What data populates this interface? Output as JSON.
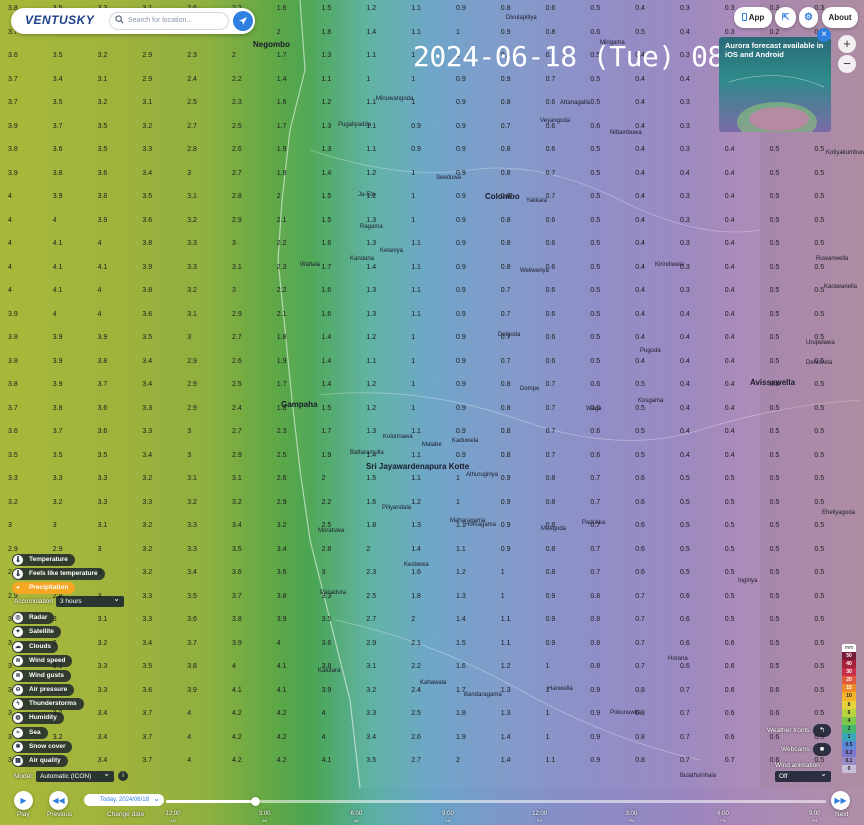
{
  "header": {
    "logo": "VENTUSKY",
    "search_placeholder": "Search for location..."
  },
  "datetime": "2024-06-18 (Tue) 08:30AM",
  "top_buttons": {
    "app": "App",
    "about": "About"
  },
  "promo": {
    "text": "Aurora forecast available in iOS and Android"
  },
  "map": {
    "cities": [
      {
        "name": "Colombo"
      },
      {
        "name": "Gampaha"
      },
      {
        "name": "Avissawella"
      },
      {
        "name": "Sri Jayawardenapura Kotte"
      },
      {
        "name": "Negombo"
      }
    ],
    "places": [
      {
        "name": "Ragama"
      },
      {
        "name": "Kelaniya"
      },
      {
        "name": "Wattala"
      },
      {
        "name": "Delgoda"
      },
      {
        "name": "Dompe"
      },
      {
        "name": "Kaduwela"
      },
      {
        "name": "Homagama"
      },
      {
        "name": "Padukka"
      },
      {
        "name": "Hanwella"
      },
      {
        "name": "Kosgama"
      },
      {
        "name": "Kirindiwela"
      },
      {
        "name": "Nittambuwa"
      },
      {
        "name": "Yakkala"
      },
      {
        "name": "Weliweriya"
      },
      {
        "name": "Minuwangoda"
      },
      {
        "name": "Divulapitiya"
      },
      {
        "name": "Veyangoda"
      },
      {
        "name": "Pugoda"
      },
      {
        "name": "Ruwanwella"
      },
      {
        "name": "Kotiyakumbura"
      },
      {
        "name": "Karawanella"
      },
      {
        "name": "Dehiowita"
      },
      {
        "name": "Urupelawa"
      },
      {
        "name": "Eheliyagoda"
      },
      {
        "name": "Kalutara"
      },
      {
        "name": "Panadura"
      },
      {
        "name": "Moratuwa"
      },
      {
        "name": "Horana"
      },
      {
        "name": "Ingiriya"
      },
      {
        "name": "Bulathsinhala"
      },
      {
        "name": "Maharagama"
      },
      {
        "name": "Kesbewa"
      },
      {
        "name": "Piliyandala"
      },
      {
        "name": "Malabe"
      },
      {
        "name": "Athurugiriya"
      },
      {
        "name": "Battaramulla"
      },
      {
        "name": "Kolonnawa"
      },
      {
        "name": "Ja-Ela"
      },
      {
        "name": "Kandana"
      },
      {
        "name": "Seeduwa"
      },
      {
        "name": "Mirigama"
      },
      {
        "name": "Attanagalla"
      },
      {
        "name": "Pugaliyadda"
      },
      {
        "name": "Waga"
      },
      {
        "name": "Meegoda"
      },
      {
        "name": "Kahawala"
      },
      {
        "name": "Bandaragama"
      },
      {
        "name": "Pokunuwita"
      }
    ]
  },
  "layers": [
    {
      "label": "Temperature",
      "icon": "thermometer-icon"
    },
    {
      "label": "Feels like temperature",
      "icon": "thermometer-icon"
    },
    {
      "label": "Precipitation",
      "icon": "drop-icon",
      "active": true
    },
    {
      "label": "Radar",
      "icon": "radar-icon"
    },
    {
      "label": "Satellite",
      "icon": "satellite-icon"
    },
    {
      "label": "Clouds",
      "icon": "cloud-icon"
    },
    {
      "label": "Wind speed",
      "icon": "wind-icon"
    },
    {
      "label": "Wind gusts",
      "icon": "wind-icon"
    },
    {
      "label": "Air pressure",
      "icon": "pressure-icon"
    },
    {
      "label": "Thunderstorms",
      "icon": "lightning-icon"
    },
    {
      "label": "Humidity",
      "icon": "humidity-icon"
    },
    {
      "label": "Sea",
      "icon": "waves-icon"
    },
    {
      "label": "Snow cover",
      "icon": "snowflake-icon"
    },
    {
      "label": "Air quality",
      "icon": "air-quality-icon"
    }
  ],
  "accumulation": {
    "label": "Accumulation:",
    "value": "3 hours"
  },
  "model": {
    "label": "Model:",
    "value": "Automatic (ICON)"
  },
  "legend": {
    "unit": "mm",
    "values": [
      "50",
      "40",
      "30",
      "20",
      "15",
      "10",
      "8",
      "6",
      "4",
      "2",
      "1",
      "0.5",
      "0.2",
      "0.1",
      "0"
    ],
    "colors": [
      "#7a1a3a",
      "#a8213c",
      "#c8304a",
      "#e25a3c",
      "#ef8a2a",
      "#f4b22a",
      "#e6d23a",
      "#b8d43e",
      "#7cc84a",
      "#44b870",
      "#3aa8b8",
      "#5a88d8",
      "#7a7ad0",
      "#9a8ac8",
      "#c8c0d8"
    ]
  },
  "side_controls": {
    "weather_fronts": "Weather fronts",
    "webcams": "Webcams",
    "wind_animation": "Wind animation",
    "wind_animation_value": "Off"
  },
  "timeline": {
    "play": "Play",
    "previous": "Previous",
    "change_date": "Change date",
    "next": "Next",
    "date_value": "Today, 2024/06/18",
    "progress": 0.135,
    "ticks": [
      {
        "time": "12:00",
        "ampm": "AM"
      },
      {
        "time": "3:00",
        "ampm": "AM"
      },
      {
        "time": "6:00",
        "ampm": "AM"
      },
      {
        "time": "9:00",
        "ampm": "AM"
      },
      {
        "time": "12:00",
        "ampm": "PM"
      },
      {
        "time": "3:00",
        "ampm": "PM"
      },
      {
        "time": "6:00",
        "ampm": "PM"
      },
      {
        "time": "9:00",
        "ampm": "PM"
      }
    ]
  },
  "grid_values": [
    [
      "3.8",
      "3.5",
      "3.3",
      "3.1",
      "2.6",
      "2.2",
      "1.6",
      "1.5",
      "1.2",
      "1.1",
      "0.9",
      "0.8",
      "0.6",
      "0.5",
      "0.4",
      "0.3",
      "0.3",
      "0.3",
      "0.3"
    ],
    [
      "3.7",
      "3.4",
      "3.2",
      "2.9",
      "2.7",
      "2.4",
      "2",
      "1.8",
      "1.4",
      "1.1",
      "1",
      "0.9",
      "0.8",
      "0.6",
      "0.5",
      "0.4",
      "0.3",
      "0.2",
      "0.3"
    ],
    [
      "3.6",
      "3.5",
      "3.2",
      "2.9",
      "2.3",
      "2",
      "1.7",
      "1.3",
      "1.1",
      "1",
      "1",
      "0.9",
      "0.7",
      "0.5",
      "0.4",
      "0.3",
      "0.3",
      "0.3",
      "0.3"
    ],
    [
      "3.7",
      "3.4",
      "3.1",
      "2.9",
      "2.4",
      "2.2",
      "1.4",
      "1.1",
      "1",
      "1",
      "0.9",
      "0.9",
      "0.7",
      "0.5",
      "0.4",
      "0.4",
      "0.3",
      "0.4",
      "0.4"
    ],
    [
      "3.7",
      "3.5",
      "3.2",
      "3.1",
      "2.5",
      "2.3",
      "1.6",
      "1.2",
      "1.1",
      "1",
      "0.9",
      "0.8",
      "0.6",
      "0.5",
      "0.4",
      "0.3",
      "0.3",
      "0.4",
      "0.4"
    ],
    [
      "3.9",
      "3.7",
      "3.5",
      "3.2",
      "2.7",
      "2.5",
      "1.7",
      "1.3",
      "1.1",
      "0.9",
      "0.9",
      "0.7",
      "0.6",
      "0.6",
      "0.4",
      "0.3",
      "0.4",
      "0.4",
      "0.5"
    ],
    [
      "3.8",
      "3.6",
      "3.5",
      "3.3",
      "2.8",
      "2.6",
      "1.9",
      "1.3",
      "1.1",
      "0.9",
      "0.9",
      "0.8",
      "0.6",
      "0.5",
      "0.4",
      "0.3",
      "0.4",
      "0.5",
      "0.5"
    ],
    [
      "3.9",
      "3.8",
      "3.6",
      "3.4",
      "3",
      "2.7",
      "1.8",
      "1.4",
      "1.2",
      "1",
      "0.9",
      "0.8",
      "0.7",
      "0.5",
      "0.4",
      "0.4",
      "0.4",
      "0.5",
      "0.5"
    ],
    [
      "4",
      "3.9",
      "3.8",
      "3.5",
      "3.1",
      "2.8",
      "2",
      "1.5",
      "1.2",
      "1",
      "0.9",
      "0.8",
      "0.7",
      "0.5",
      "0.4",
      "0.3",
      "0.4",
      "0.5",
      "0.5"
    ],
    [
      "4",
      "4",
      "3.9",
      "3.6",
      "3.2",
      "2.9",
      "2.1",
      "1.5",
      "1.3",
      "1",
      "0.9",
      "0.8",
      "0.6",
      "0.5",
      "0.4",
      "0.3",
      "0.4",
      "0.5",
      "0.5"
    ],
    [
      "4",
      "4.1",
      "4",
      "3.8",
      "3.3",
      "3",
      "2.2",
      "1.6",
      "1.3",
      "1.1",
      "0.9",
      "0.8",
      "0.6",
      "0.5",
      "0.4",
      "0.3",
      "0.4",
      "0.5",
      "0.5"
    ],
    [
      "4",
      "4.1",
      "4.1",
      "3.9",
      "3.3",
      "3.1",
      "2.3",
      "1.7",
      "1.4",
      "1.1",
      "0.9",
      "0.8",
      "0.6",
      "0.5",
      "0.4",
      "0.3",
      "0.4",
      "0.5",
      "0.5"
    ],
    [
      "4",
      "4.1",
      "4",
      "3.8",
      "3.2",
      "3",
      "2.2",
      "1.6",
      "1.3",
      "1.1",
      "0.9",
      "0.7",
      "0.6",
      "0.5",
      "0.4",
      "0.3",
      "0.4",
      "0.5",
      "0.5"
    ],
    [
      "3.9",
      "4",
      "4",
      "3.6",
      "3.1",
      "2.9",
      "2.1",
      "1.6",
      "1.3",
      "1.1",
      "0.9",
      "0.7",
      "0.6",
      "0.5",
      "0.4",
      "0.4",
      "0.4",
      "0.5",
      "0.5"
    ],
    [
      "3.8",
      "3.9",
      "3.9",
      "3.5",
      "3",
      "2.7",
      "1.8",
      "1.4",
      "1.2",
      "1",
      "0.9",
      "0.7",
      "0.6",
      "0.5",
      "0.4",
      "0.4",
      "0.4",
      "0.5",
      "0.5"
    ],
    [
      "3.8",
      "3.9",
      "3.8",
      "3.4",
      "2.9",
      "2.6",
      "1.9",
      "1.4",
      "1.1",
      "1",
      "0.9",
      "0.7",
      "0.6",
      "0.5",
      "0.4",
      "0.4",
      "0.4",
      "0.5",
      "0.5"
    ],
    [
      "3.8",
      "3.9",
      "3.7",
      "3.4",
      "2.9",
      "2.5",
      "1.7",
      "1.4",
      "1.2",
      "1",
      "0.9",
      "0.8",
      "0.7",
      "0.6",
      "0.5",
      "0.4",
      "0.4",
      "0.5",
      "0.5"
    ],
    [
      "3.7",
      "3.8",
      "3.6",
      "3.3",
      "2.9",
      "2.4",
      "1.8",
      "1.5",
      "1.2",
      "1",
      "0.9",
      "0.8",
      "0.7",
      "0.6",
      "0.5",
      "0.4",
      "0.4",
      "0.5",
      "0.5"
    ],
    [
      "3.6",
      "3.7",
      "3.6",
      "3.3",
      "3",
      "2.7",
      "2.3",
      "1.7",
      "1.3",
      "1.1",
      "0.9",
      "0.8",
      "0.7",
      "0.6",
      "0.5",
      "0.4",
      "0.4",
      "0.5",
      "0.5"
    ],
    [
      "3.5",
      "3.5",
      "3.5",
      "3.4",
      "3",
      "2.9",
      "2.5",
      "1.9",
      "1.4",
      "1.1",
      "0.9",
      "0.8",
      "0.7",
      "0.6",
      "0.5",
      "0.4",
      "0.4",
      "0.5",
      "0.5"
    ],
    [
      "3.3",
      "3.3",
      "3.3",
      "3.2",
      "3.1",
      "3.1",
      "2.6",
      "2",
      "1.5",
      "1.1",
      "1",
      "0.9",
      "0.8",
      "0.7",
      "0.6",
      "0.5",
      "0.5",
      "0.5",
      "0.5"
    ],
    [
      "3.2",
      "3.2",
      "3.3",
      "3.3",
      "3.2",
      "3.2",
      "2.9",
      "2.2",
      "1.6",
      "1.2",
      "1",
      "0.9",
      "0.8",
      "0.7",
      "0.6",
      "0.5",
      "0.5",
      "0.5",
      "0.5"
    ],
    [
      "3",
      "3",
      "3.1",
      "3.2",
      "3.3",
      "3.4",
      "3.2",
      "2.5",
      "1.8",
      "1.3",
      "1.1",
      "0.9",
      "0.8",
      "0.7",
      "0.6",
      "0.5",
      "0.5",
      "0.5",
      "0.5"
    ],
    [
      "2.9",
      "2.9",
      "3",
      "3.2",
      "3.3",
      "3.5",
      "3.4",
      "2.8",
      "2",
      "1.4",
      "1.1",
      "0.9",
      "0.8",
      "0.7",
      "0.6",
      "0.5",
      "0.5",
      "0.5",
      "0.5"
    ],
    [
      "2.9",
      "2.9",
      "3",
      "3.2",
      "3.4",
      "3.6",
      "3.6",
      "3",
      "2.3",
      "1.6",
      "1.2",
      "1",
      "0.8",
      "0.7",
      "0.6",
      "0.5",
      "0.5",
      "0.5",
      "0.5"
    ],
    [
      "2.9",
      "2.9",
      "3",
      "3.3",
      "3.5",
      "3.7",
      "3.8",
      "3.3",
      "2.5",
      "1.8",
      "1.3",
      "1",
      "0.9",
      "0.8",
      "0.7",
      "0.6",
      "0.5",
      "0.5",
      "0.5"
    ],
    [
      "3",
      "3",
      "3.1",
      "3.3",
      "3.6",
      "3.8",
      "3.9",
      "3.5",
      "2.7",
      "2",
      "1.4",
      "1.1",
      "0.9",
      "0.8",
      "0.7",
      "0.6",
      "0.5",
      "0.5",
      "0.5"
    ],
    [
      "3",
      "3",
      "3.2",
      "3.4",
      "3.7",
      "3.9",
      "4",
      "3.6",
      "2.9",
      "2.1",
      "1.5",
      "1.1",
      "0.9",
      "0.8",
      "0.7",
      "0.6",
      "0.6",
      "0.5",
      "0.5"
    ],
    [
      "3",
      "3.1",
      "3.3",
      "3.5",
      "3.8",
      "4",
      "4.1",
      "3.8",
      "3.1",
      "2.2",
      "1.6",
      "1.2",
      "1",
      "0.8",
      "0.7",
      "0.6",
      "0.6",
      "0.5",
      "0.5"
    ],
    [
      "3",
      "3.1",
      "3.3",
      "3.6",
      "3.9",
      "4.1",
      "4.1",
      "3.9",
      "3.2",
      "2.4",
      "1.7",
      "1.3",
      "1",
      "0.9",
      "0.8",
      "0.7",
      "0.6",
      "0.6",
      "0.5"
    ],
    [
      "3",
      "3.2",
      "3.4",
      "3.7",
      "4",
      "4.2",
      "4.2",
      "4",
      "3.3",
      "2.5",
      "1.8",
      "1.3",
      "1",
      "0.9",
      "0.8",
      "0.7",
      "0.6",
      "0.6",
      "0.5"
    ],
    [
      "3",
      "3.2",
      "3.4",
      "3.7",
      "4",
      "4.2",
      "4.2",
      "4",
      "3.4",
      "2.6",
      "1.9",
      "1.4",
      "1",
      "0.9",
      "0.8",
      "0.7",
      "0.6",
      "0.6",
      "0.5"
    ],
    [
      "3",
      "3.2",
      "3.4",
      "3.7",
      "4",
      "4.2",
      "4.2",
      "4.1",
      "3.5",
      "2.7",
      "2",
      "1.4",
      "1.1",
      "0.9",
      "0.8",
      "0.7",
      "0.7",
      "0.6",
      "0.5"
    ]
  ]
}
